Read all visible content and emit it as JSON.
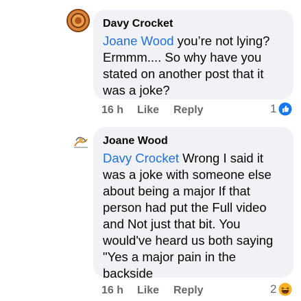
{
  "comments": [
    {
      "author": "Davy Crocket",
      "mention": "Joane Wood",
      "lines": [
        " you’re not lying?",
        "Ermmm.... So why have you",
        "stated on another post that it",
        "was a joke?"
      ],
      "time": "16 h",
      "like_label": "Like",
      "reply_label": "Reply",
      "reaction_count": "1",
      "reaction_icon": "like-icon",
      "avatar_icon": "orange-circle-avatar"
    },
    {
      "author": "Joane Wood",
      "mention": "Davy Crocket",
      "lines": [
        " Wrong I said it",
        "was a joke with someone else",
        "about being a major If that",
        "person had put the Full video",
        "and Not just that bit. You",
        "would've heard us both saying",
        "\"Yes a major pain in the",
        "backside"
      ],
      "time": "16 h",
      "like_label": "Like",
      "reply_label": "Reply",
      "reaction_count": "2",
      "reaction_icon": "haha-icon",
      "avatar_icon": "sketch-avatar"
    }
  ],
  "colors": {
    "mention": "#216fdb",
    "bubble": "#f0f2f5",
    "meta": "#65676b",
    "like_blue": "#1877f2",
    "haha_yellow": "#f7b125"
  }
}
